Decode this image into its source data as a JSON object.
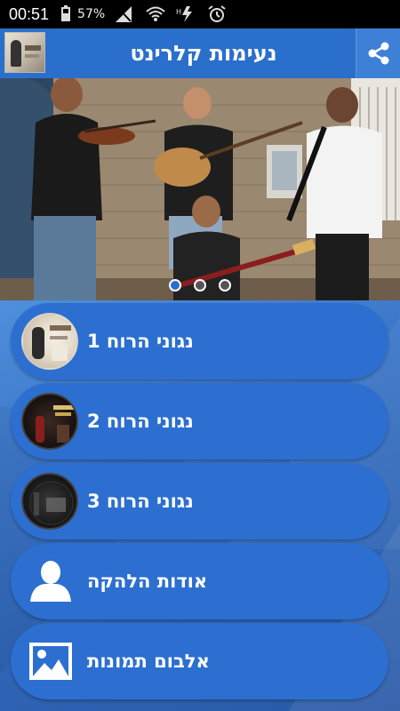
{
  "status_bar": {
    "time": "00:51",
    "battery_percent": "57%",
    "icons": [
      "battery-icon",
      "signal-icon",
      "wifi-icon",
      "data-icon",
      "alarm-icon"
    ]
  },
  "header": {
    "title": "נעימות קלרינט",
    "share_icon": "share-icon"
  },
  "banner": {
    "pager_count": 3,
    "active_index": 0
  },
  "menu": {
    "items": [
      {
        "label": "נגוני הרוח 1",
        "icon": "album-cover-1"
      },
      {
        "label": "נגוני הרוח 2",
        "icon": "album-cover-2"
      },
      {
        "label": "נגוני הרוח 3",
        "icon": "album-cover-3"
      },
      {
        "label": "אודות הלהקה",
        "icon": "person-icon"
      },
      {
        "label": "אלבום תמונות",
        "icon": "image-icon"
      }
    ]
  },
  "colors": {
    "primary": "#2a6fcc",
    "menu_item": "#2c6fd0",
    "status_bar": "#000000"
  }
}
